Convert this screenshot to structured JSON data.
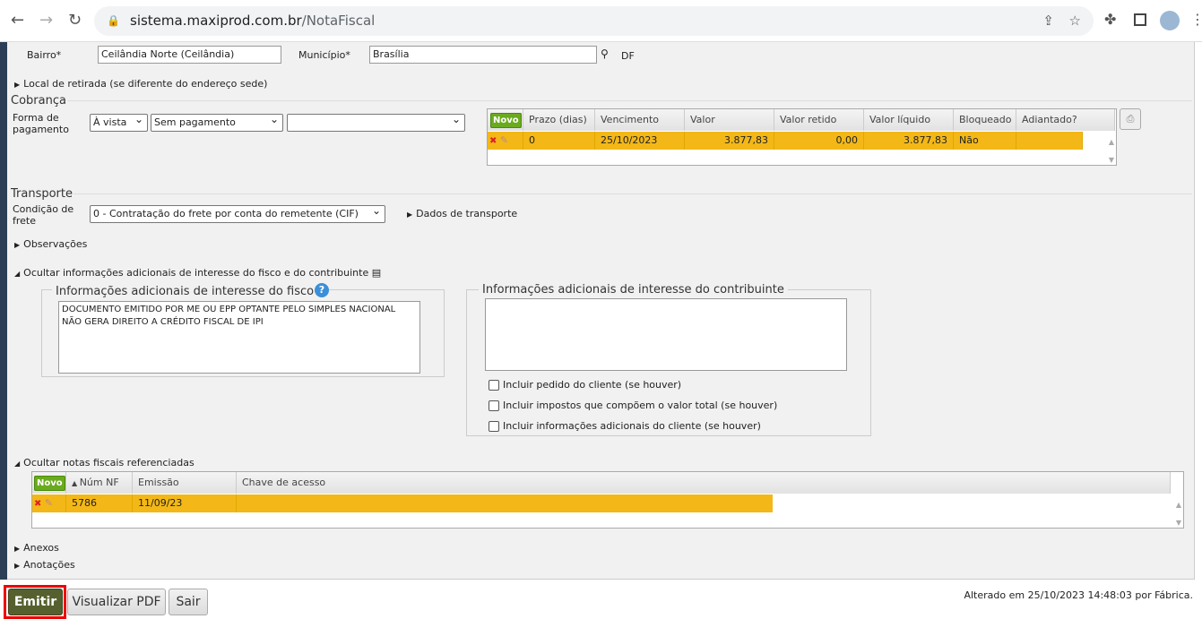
{
  "browser": {
    "url_host": "sistema.maxiprod.com.br",
    "url_path": "/NotaFiscal"
  },
  "endereco": {
    "bairro_label": "Bairro*",
    "bairro_value": "Ceilândia Norte (Ceilândia)",
    "municipio_label": "Município*",
    "municipio_value": "Brasília",
    "uf": "DF"
  },
  "local_retirada": "Local de retirada (se diferente do endereço sede)",
  "cobranca": {
    "title": "Cobrança",
    "forma_label": "Forma de pagamento",
    "forma_value": "À vista",
    "meio_value": "Sem pagamento",
    "extra_value": "",
    "novo": "Novo",
    "headers": [
      "Prazo (dias)",
      "Vencimento",
      "Valor",
      "Valor retido",
      "Valor líquido",
      "Bloqueado",
      "Adiantado?"
    ],
    "rows": [
      [
        "0",
        "25/10/2023",
        "3.877,83",
        "0,00",
        "3.877,83",
        "Não",
        ""
      ]
    ]
  },
  "transporte": {
    "title": "Transporte",
    "condicao_label": "Condição de frete",
    "condicao_value": "0 - Contratação do frete por conta do remetente (CIF)",
    "dados_link": "Dados de transporte"
  },
  "observacoes": "Observações",
  "info_toggle": "Ocultar informações adicionais de interesse do fisco e do contribuinte",
  "fisco": {
    "title": "Informações adicionais de interesse do fisco",
    "text": "DOCUMENTO EMITIDO POR ME OU EPP OPTANTE PELO SIMPLES NACIONAL NÃO GERA DIREITO A CRÉDITO FISCAL DE IPI"
  },
  "contribuinte": {
    "title": "Informações adicionais de interesse do contribuinte",
    "text": "",
    "checks": [
      "Incluir pedido do cliente (se houver)",
      "Incluir impostos que compõem o valor total (se houver)",
      "Incluir informações adicionais do cliente (se houver)"
    ]
  },
  "referenciadas": {
    "toggle": "Ocultar notas fiscais referenciadas",
    "novo": "Novo",
    "headers": [
      "Núm NF",
      "Emissão",
      "Chave de acesso"
    ],
    "rows": [
      [
        "5786",
        "11/09/23",
        ""
      ]
    ]
  },
  "anexos": "Anexos",
  "anotacoes": "Anotações",
  "footer": {
    "emitir": "Emitir",
    "pdf": "Visualizar PDF",
    "sair": "Sair",
    "status": "Alterado em 25/10/2023 14:48:03 por Fábrica."
  }
}
